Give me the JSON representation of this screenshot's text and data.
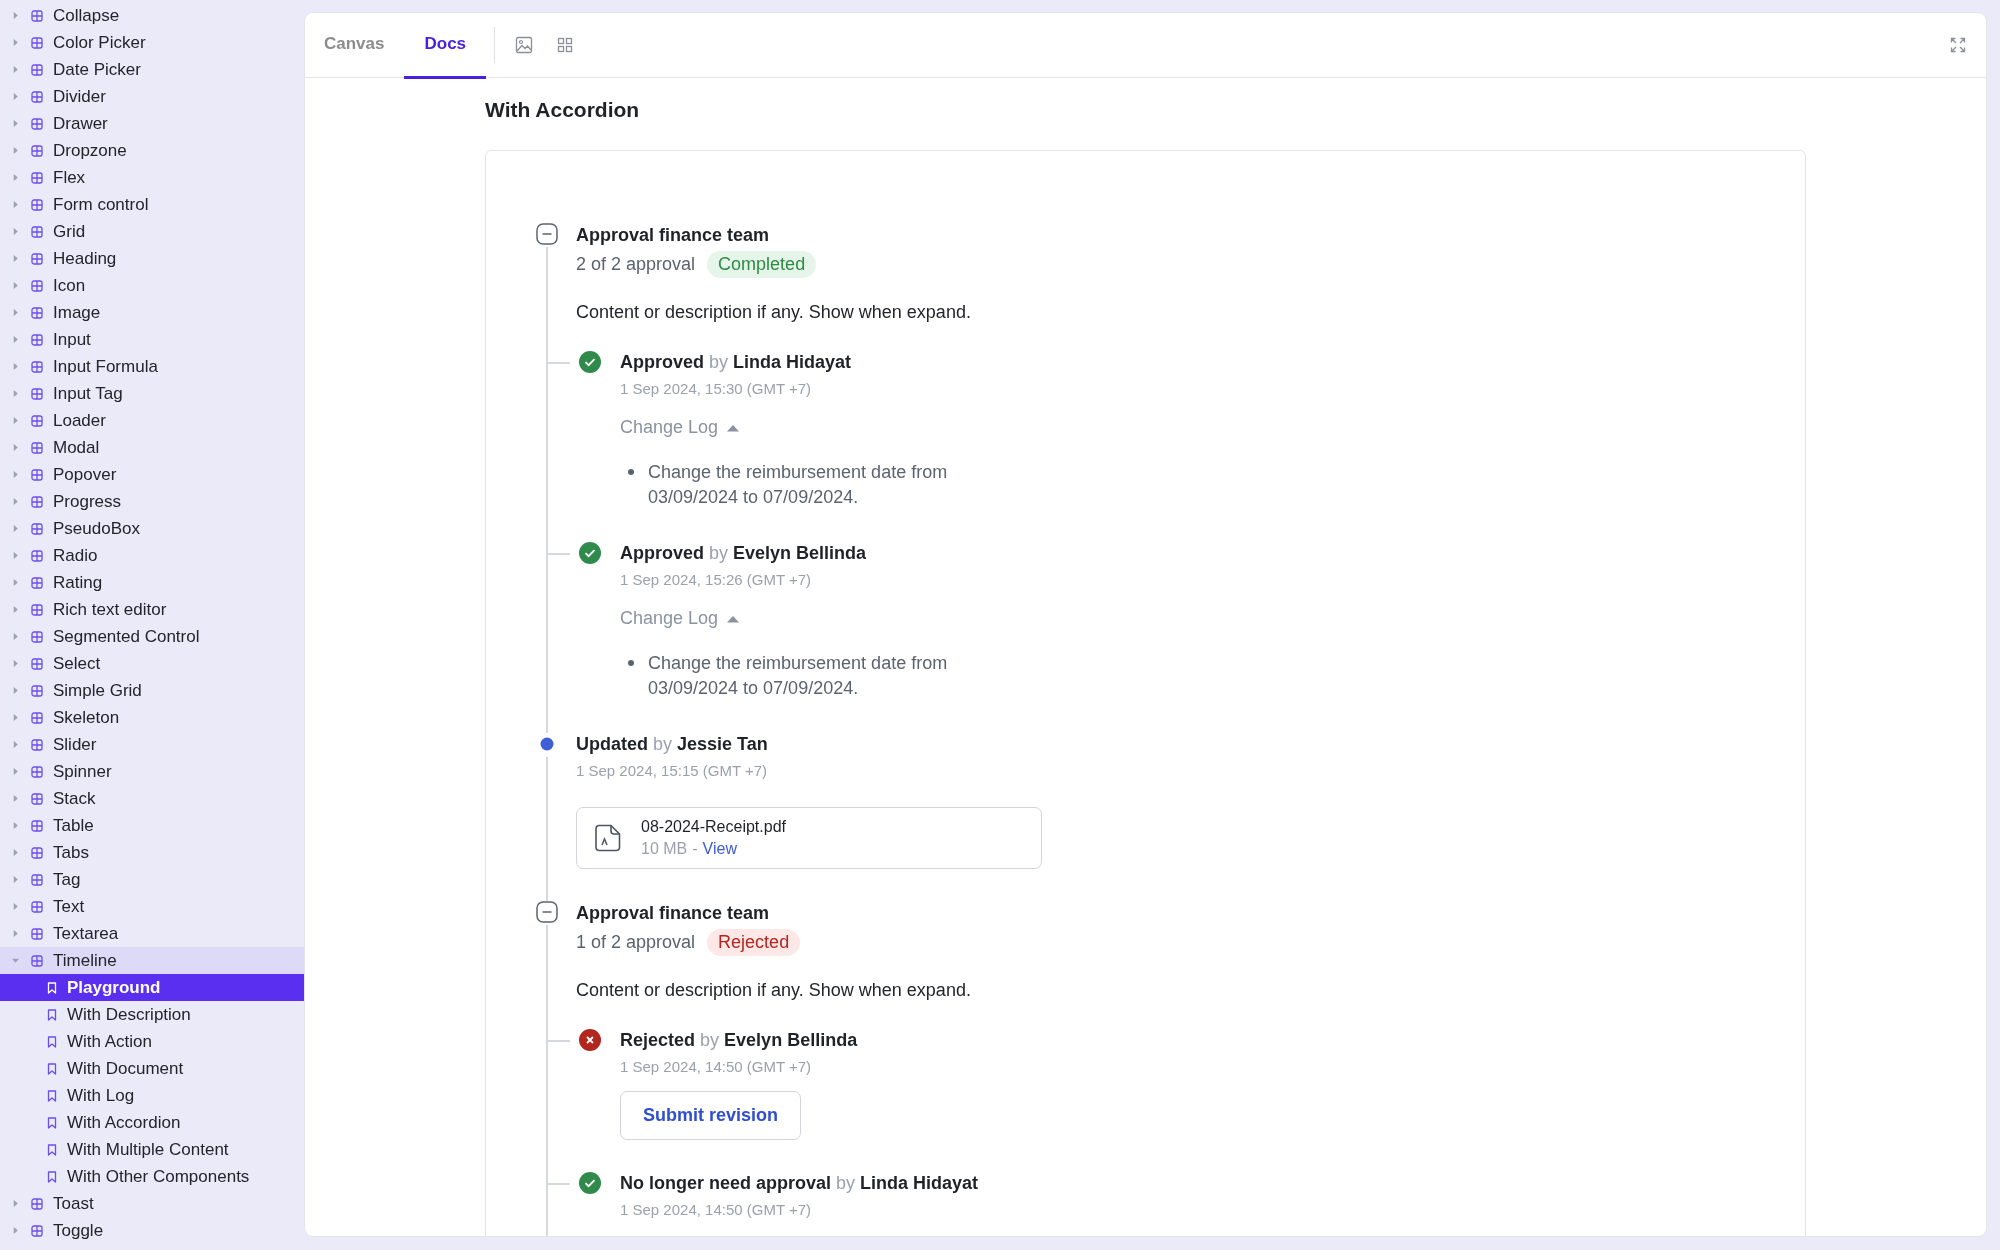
{
  "sidebar": {
    "items": [
      {
        "label": "Collapse",
        "expanded": false
      },
      {
        "label": "Color Picker",
        "expanded": false
      },
      {
        "label": "Date Picker",
        "expanded": false
      },
      {
        "label": "Divider",
        "expanded": false
      },
      {
        "label": "Drawer",
        "expanded": false
      },
      {
        "label": "Dropzone",
        "expanded": false
      },
      {
        "label": "Flex",
        "expanded": false
      },
      {
        "label": "Form control",
        "expanded": false
      },
      {
        "label": "Grid",
        "expanded": false
      },
      {
        "label": "Heading",
        "expanded": false
      },
      {
        "label": "Icon",
        "expanded": false
      },
      {
        "label": "Image",
        "expanded": false
      },
      {
        "label": "Input",
        "expanded": false
      },
      {
        "label": "Input Formula",
        "expanded": false
      },
      {
        "label": "Input Tag",
        "expanded": false
      },
      {
        "label": "Loader",
        "expanded": false
      },
      {
        "label": "Modal",
        "expanded": false
      },
      {
        "label": "Popover",
        "expanded": false
      },
      {
        "label": "Progress",
        "expanded": false
      },
      {
        "label": "PseudoBox",
        "expanded": false
      },
      {
        "label": "Radio",
        "expanded": false
      },
      {
        "label": "Rating",
        "expanded": false
      },
      {
        "label": "Rich text editor",
        "expanded": false
      },
      {
        "label": "Segmented Control",
        "expanded": false
      },
      {
        "label": "Select",
        "expanded": false
      },
      {
        "label": "Simple Grid",
        "expanded": false
      },
      {
        "label": "Skeleton",
        "expanded": false
      },
      {
        "label": "Slider",
        "expanded": false
      },
      {
        "label": "Spinner",
        "expanded": false
      },
      {
        "label": "Stack",
        "expanded": false
      },
      {
        "label": "Table",
        "expanded": false
      },
      {
        "label": "Tabs",
        "expanded": false
      },
      {
        "label": "Tag",
        "expanded": false
      },
      {
        "label": "Text",
        "expanded": false
      },
      {
        "label": "Textarea",
        "expanded": false
      },
      {
        "label": "Timeline",
        "expanded": true,
        "children": [
          {
            "label": "Playground",
            "selected": true
          },
          {
            "label": "With Description",
            "selected": false
          },
          {
            "label": "With Action",
            "selected": false
          },
          {
            "label": "With Document",
            "selected": false
          },
          {
            "label": "With Log",
            "selected": false
          },
          {
            "label": "With Accordion",
            "selected": false
          },
          {
            "label": "With Multiple Content",
            "selected": false
          },
          {
            "label": "With Other Components",
            "selected": false
          }
        ]
      },
      {
        "label": "Toast",
        "expanded": false
      },
      {
        "label": "Toggle",
        "expanded": false
      }
    ]
  },
  "tabs": [
    {
      "label": "Canvas",
      "selected": false
    },
    {
      "label": "Docs",
      "selected": true
    }
  ],
  "heading": "With Accordion",
  "timeline": [
    {
      "kind": "group",
      "expanded": true,
      "title": "Approval finance team",
      "summary": "2 of 2 approval",
      "badge": {
        "label": "Completed",
        "kind": "success"
      },
      "description": "Content or description if any. Show when expand.",
      "children": [
        {
          "kind": "approved",
          "action": "Approved",
          "by": "by",
          "person": "Linda Hidayat",
          "time": "1 Sep 2024, 15:30 (GMT +7)",
          "log": {
            "label": "Change Log",
            "expanded": true,
            "entries": [
              "Change the reimbursement date from 03/09/2024 to 07/09/2024."
            ]
          }
        },
        {
          "kind": "approved",
          "action": "Approved",
          "by": "by",
          "person": "Evelyn Bellinda",
          "time": "1 Sep 2024, 15:26 (GMT +7)",
          "log": {
            "label": "Change Log",
            "expanded": true,
            "entries": [
              "Change the reimbursement date from 03/09/2024 to 07/09/2024."
            ]
          }
        }
      ]
    },
    {
      "kind": "updated",
      "action": "Updated",
      "by": "by",
      "person": "Jessie Tan",
      "time": "1 Sep 2024, 15:15 (GMT +7)",
      "file": {
        "name": "08-2024-Receipt.pdf",
        "size": "10 MB",
        "separator": "-",
        "link": "View"
      }
    },
    {
      "kind": "group",
      "expanded": true,
      "title": "Approval finance team",
      "summary": "1 of 2 approval",
      "badge": {
        "label": "Rejected",
        "kind": "danger"
      },
      "description": "Content or description if any. Show when expand.",
      "children": [
        {
          "kind": "rejected",
          "action": "Rejected",
          "by": "by",
          "person": "Evelyn Bellinda",
          "time": "1 Sep 2024, 14:50 (GMT +7)",
          "button": "Submit revision"
        },
        {
          "kind": "approved",
          "action": "No longer need approval",
          "by": "by",
          "person": "Linda Hidayat",
          "time": "1 Sep 2024, 14:50 (GMT +7)"
        }
      ]
    }
  ]
}
